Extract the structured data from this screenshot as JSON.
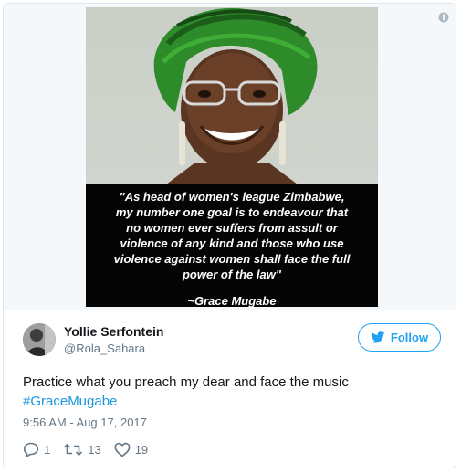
{
  "image": {
    "quote_lines": "\"As head of women's league Zimbabwe,\nmy number one goal is to endeavour that\nno women ever suffers from assult or\nviolence of any kind and those who use\nviolence against women shall face the full\npower of the law\"",
    "quote_author": "~Grace Mugabe"
  },
  "tweet": {
    "user_name": "Yollie Serfontein",
    "user_handle": "@Rola_Sahara",
    "follow_label": "Follow",
    "text": "Practice what you preach my dear and face the music",
    "hashtag": "#GraceMugabe",
    "timestamp": "9:56 AM - Aug 17, 2017",
    "reply_count": "1",
    "retweet_count": "13",
    "like_count": "19"
  },
  "icons": {
    "info": "info-icon",
    "twitter_bird": "twitter-bird-icon",
    "reply": "reply-icon",
    "retweet": "retweet-icon",
    "like": "heart-icon"
  },
  "colors": {
    "accent": "#1da1f2",
    "hashtag": "#1b95e0",
    "muted": "#657786",
    "text": "#14171a",
    "border": "#e1e8ed"
  }
}
